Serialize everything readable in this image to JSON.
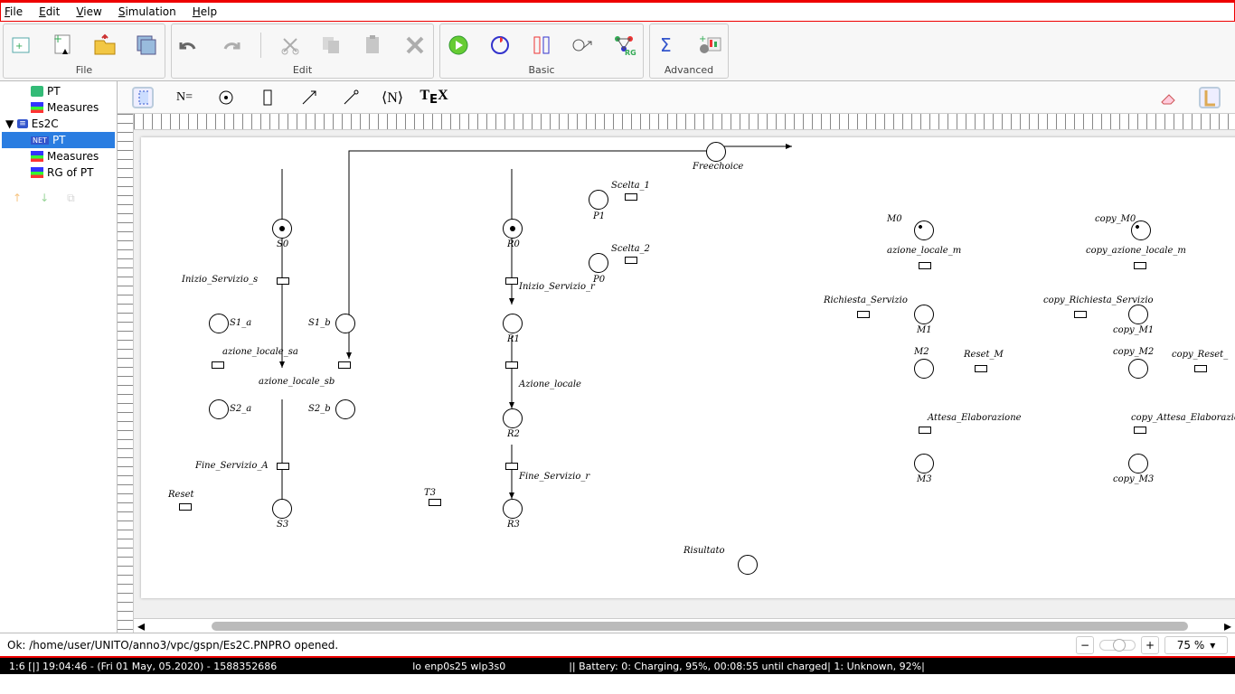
{
  "menu": {
    "file": "File",
    "edit": "Edit",
    "view": "View",
    "simulation": "Simulation",
    "help": "Help"
  },
  "toolbar": {
    "groups": {
      "file": "File",
      "edit": "Edit",
      "basic": "Basic",
      "advanced": "Advanced"
    }
  },
  "sidebar": {
    "pt": "PT",
    "measures": "Measures",
    "project": "Es2C",
    "pt2": "PT",
    "measures2": "Measures",
    "rg": "RG of PT"
  },
  "tooltabs": {
    "neq": "N=",
    "angle": "⟨N⟩",
    "tex": "TEX"
  },
  "net": {
    "freechoice": "Freechoice",
    "scelta1": "Scelta_1",
    "p1": "P1",
    "scelta2": "Scelta_2",
    "p0": "P0",
    "s0": "S0",
    "r0": "R0",
    "inizio_s": "Inizio_Servizio_s",
    "inizio_r": "Inizio_Servizio_r",
    "s1a": "S1_a",
    "s1b": "S1_b",
    "r1": "R1",
    "az_sa": "azione_locale_sa",
    "az_sb": "azione_locale_sb",
    "az_locale": "Azione_locale",
    "s2a": "S2_a",
    "s2b": "S2_b",
    "r2": "R2",
    "fine_a": "Fine_Servizio_A",
    "fine_r": "Fine_Servizio_r",
    "reset": "Reset",
    "t3": "T3",
    "s3": "S3",
    "r3": "R3",
    "risultato": "Risultato",
    "m0": "M0",
    "az_m": "azione_locale_m",
    "rich_serv": "Richiesta_Servizio",
    "m1": "M1",
    "m2": "M2",
    "reset_m": "Reset_M",
    "attesa": "Attesa_Elaborazione",
    "m3": "M3",
    "copy_m0": "copy_M0",
    "copy_az_m": "copy_azione_locale_m",
    "copy_rich": "copy_Richiesta_Servizio",
    "copy_m1": "copy_M1",
    "copy_m2": "copy_M2",
    "copy_reset": "copy_Reset_",
    "copy_attesa": "copy_Attesa_Elaborazione",
    "copy_m3": "copy_M3"
  },
  "status": {
    "message": "Ok: /home/user/UNITO/anno3/vpc/gspn/Es2C.PNPRO opened.",
    "zoom": "75 %"
  },
  "osbar": {
    "left": "1:6 [|]    19:04:46 - (Fri 01 May, 05.2020) - 1588352686",
    "mid": "lo enp0s25 wlp3s0",
    "right": "||   Battery: 0: Charging, 95%, 00:08:55 until charged| 1: Unknown, 92%|"
  },
  "icons": {
    "search": "search-icon",
    "gear": "gear-icon"
  }
}
